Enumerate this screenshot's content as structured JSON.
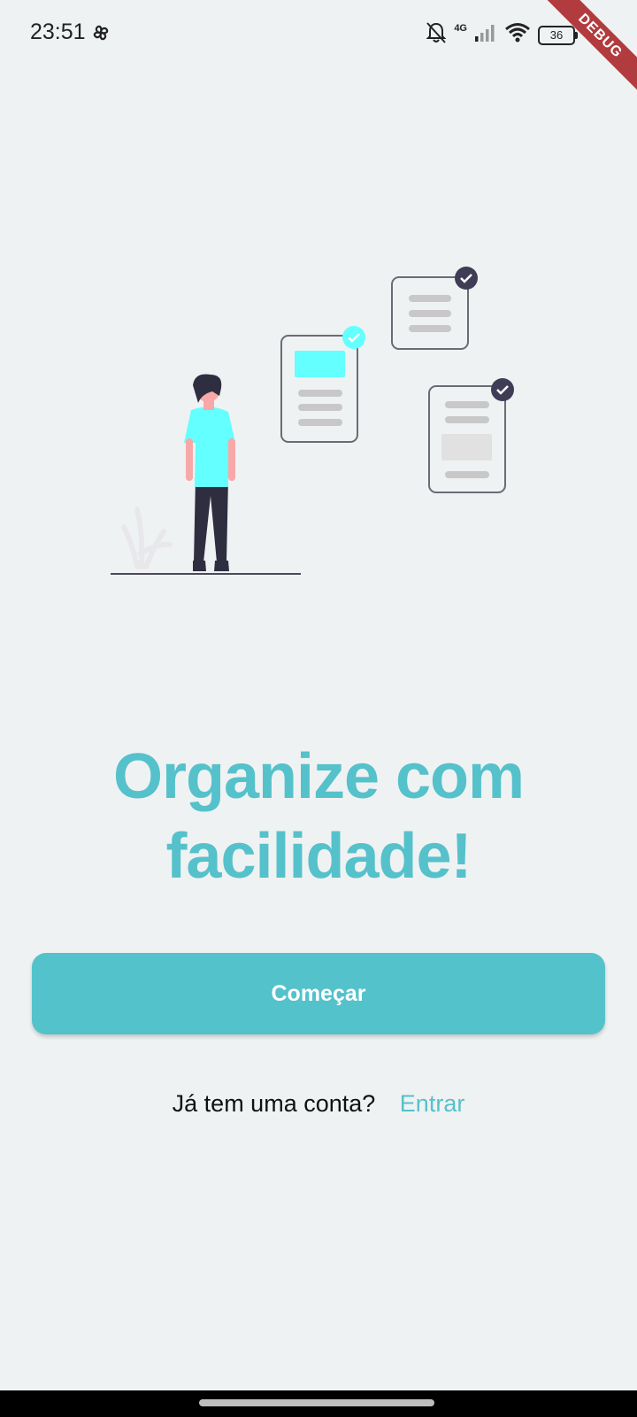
{
  "status_bar": {
    "time": "23:51",
    "network_label": "4G",
    "battery_level": "36",
    "icons": [
      "pinwheel-icon",
      "bell-muted-icon",
      "cellular-signal-icon",
      "wifi-icon",
      "battery-icon"
    ]
  },
  "debug_banner": "DEBUG",
  "onboarding": {
    "headline": "Organize com facilidade!",
    "start_button_label": "Começar",
    "login_prompt": "Já tem uma conta?",
    "login_link_label": "Entrar"
  },
  "colors": {
    "accent": "#55c1cb",
    "background": "#eff2f2",
    "illustration_highlight": "#64ffff",
    "ribbon": "#b13b3e"
  }
}
